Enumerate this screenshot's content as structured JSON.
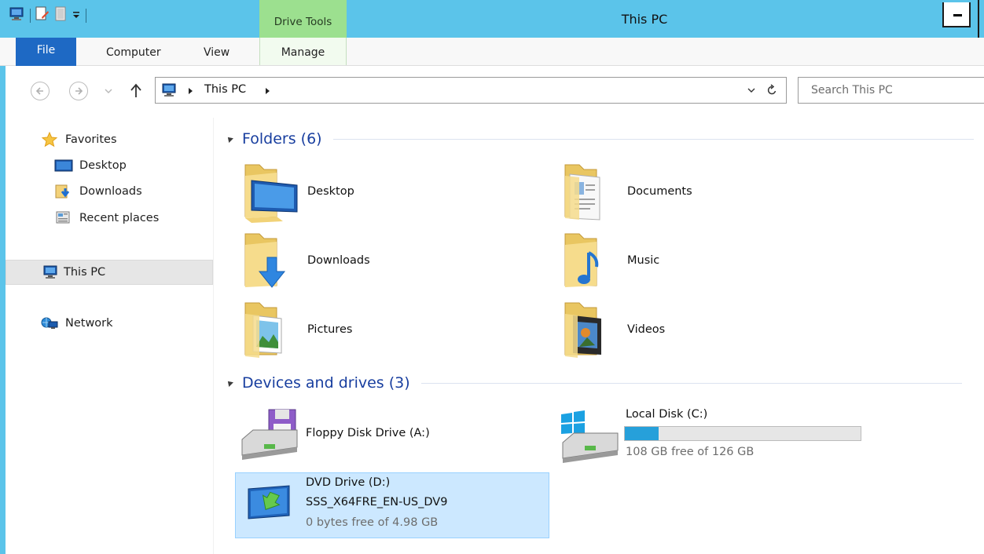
{
  "window": {
    "title": "This PC",
    "contextual_tab": "Drive Tools"
  },
  "ribbon": {
    "tabs": [
      {
        "label": "File"
      },
      {
        "label": "Computer"
      },
      {
        "label": "View"
      },
      {
        "label": "Manage"
      }
    ]
  },
  "address": {
    "path": "This PC",
    "search_placeholder": "Search This PC"
  },
  "sidebar": {
    "favorites": "Favorites",
    "favorites_items": [
      "Desktop",
      "Downloads",
      "Recent places"
    ],
    "this_pc": "This PC",
    "network": "Network"
  },
  "content": {
    "folders_header": "Folders (6)",
    "folders": [
      "Desktop",
      "Documents",
      "Downloads",
      "Music",
      "Pictures",
      "Videos"
    ],
    "devices_header": "Devices and drives (3)",
    "devices": [
      {
        "name": "Floppy Disk Drive (A:)"
      },
      {
        "name": "Local Disk (C:)",
        "free_text": "108 GB free of 126 GB",
        "used_fraction": 0.143
      },
      {
        "name": "DVD Drive (D:)",
        "volume": "SSS_X64FRE_EN-US_DV9",
        "free_text": "0 bytes free of 4.98 GB"
      }
    ]
  },
  "colors": {
    "titlebar": "#5bc4ea",
    "contextual": "#9ce08f",
    "file_tab": "#1e69c4",
    "header_text": "#183e9f",
    "selection": "#cce8ff"
  }
}
